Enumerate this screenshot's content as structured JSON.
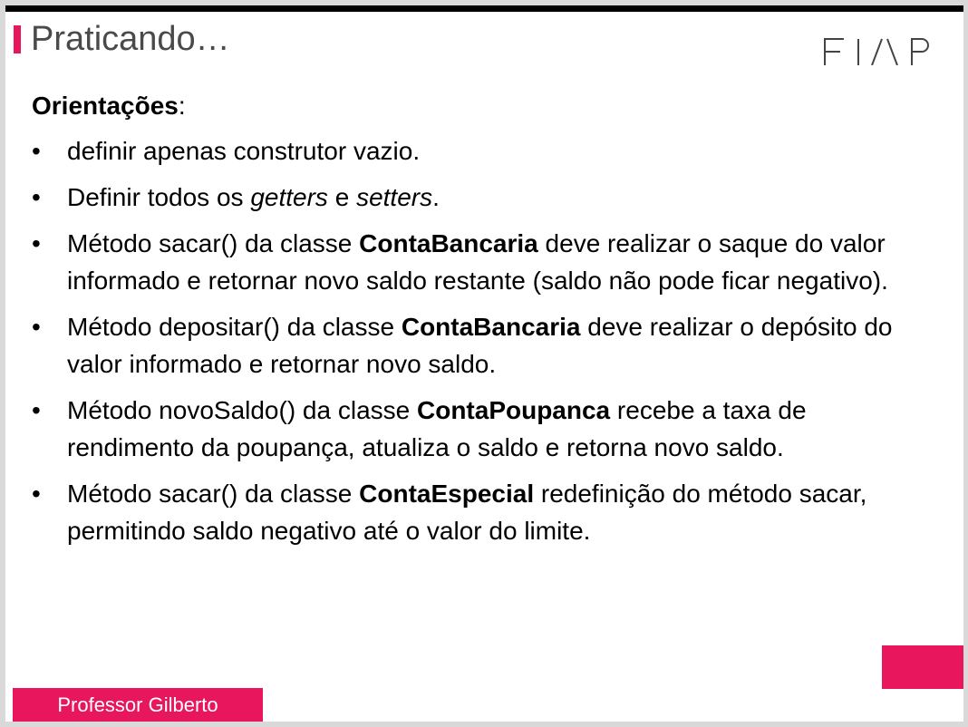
{
  "slide": {
    "title": "Praticando…",
    "logo_text": "FIAP",
    "heading": {
      "bold": "Orientações",
      "suffix": ":"
    },
    "items": [
      {
        "bullet": "•",
        "segments": [
          {
            "text": "definir apenas construtor vazio.",
            "style": "normal"
          }
        ]
      },
      {
        "bullet": "•",
        "segments": [
          {
            "text": "Definir todos os ",
            "style": "normal"
          },
          {
            "text": "getters",
            "style": "italic"
          },
          {
            "text": " e ",
            "style": "normal"
          },
          {
            "text": "setters",
            "style": "italic"
          },
          {
            "text": ".",
            "style": "normal"
          }
        ]
      },
      {
        "bullet": "•",
        "segments": [
          {
            "text": "Método sacar() da classe ",
            "style": "normal"
          },
          {
            "text": "ContaBancaria",
            "style": "bold"
          },
          {
            "text": " deve realizar o saque do valor informado e retornar novo saldo restante (saldo não pode ficar negativo).",
            "style": "normal"
          }
        ]
      },
      {
        "bullet": "•",
        "segments": [
          {
            "text": "Método depositar() da classe ",
            "style": "normal"
          },
          {
            "text": "ContaBancaria",
            "style": "bold"
          },
          {
            "text": " deve realizar o depósito do valor informado e retornar novo saldo.",
            "style": "normal"
          }
        ]
      },
      {
        "bullet": "•",
        "segments": [
          {
            "text": "Método novoSaldo() da classe ",
            "style": "normal"
          },
          {
            "text": "ContaPoupanca",
            "style": "bold"
          },
          {
            "text": " recebe a taxa de rendimento da poupança, atualiza o saldo e retorna novo saldo.",
            "style": "normal"
          }
        ]
      },
      {
        "bullet": "•",
        "segments": [
          {
            "text": "Método sacar() da classe ",
            "style": "normal"
          },
          {
            "text": "ContaEspecial",
            "style": "bold"
          },
          {
            "text": " redefinição do método sacar, permitindo saldo negativo até o valor do limite.",
            "style": "normal"
          }
        ]
      }
    ],
    "footer": "Professor Gilberto"
  },
  "colors": {
    "accent": "#e8175d",
    "title_text": "#4a4a4a",
    "body_text": "#000000",
    "top_bar": "#000000",
    "logo": "#444444",
    "background": "#ffffff"
  },
  "icons": {
    "logo": "fiap-logo"
  }
}
